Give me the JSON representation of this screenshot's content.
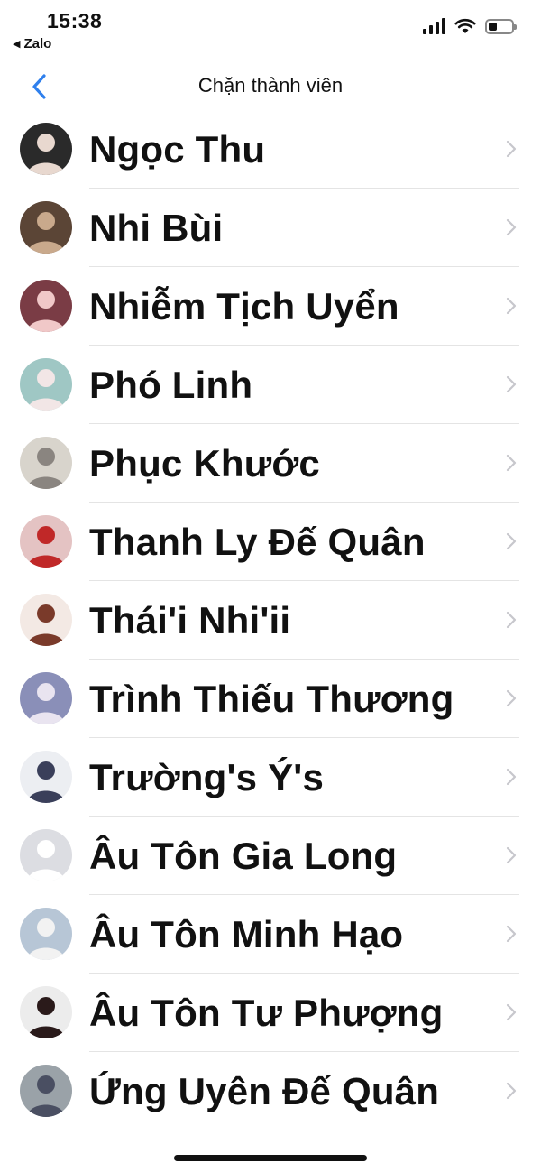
{
  "status_bar": {
    "time": "15:38",
    "back_app_label": "Zalo"
  },
  "nav": {
    "title": "Chặn thành viên",
    "back_icon": "chevron-left-icon",
    "accent_color": "#2f80ed"
  },
  "members": [
    {
      "name": "Ngọc Thu",
      "avatar": {
        "bg": "#2a2a2a",
        "fg": "#e8d8cf"
      }
    },
    {
      "name": "Nhi Bùi",
      "avatar": {
        "bg": "#5b4536",
        "fg": "#c9a98c"
      }
    },
    {
      "name": "Nhiễm Tịch Uyển",
      "avatar": {
        "bg": "#7a3c45",
        "fg": "#f0c8c8"
      }
    },
    {
      "name": "Phó Linh",
      "avatar": {
        "bg": "#9fc7c4",
        "fg": "#f2e6e6"
      }
    },
    {
      "name": "Phục Khước",
      "avatar": {
        "bg": "#d8d4cc",
        "fg": "#8a8580"
      }
    },
    {
      "name": "Thanh Ly Đế Quân",
      "avatar": {
        "bg": "#e4c3c3",
        "fg": "#c02828"
      }
    },
    {
      "name": "Thái'i Nhi'ii",
      "avatar": {
        "bg": "#f3e9e4",
        "fg": "#7a3a2a"
      }
    },
    {
      "name": "Trình Thiếu Thương",
      "avatar": {
        "bg": "#8a8fb8",
        "fg": "#e9e4f0"
      }
    },
    {
      "name": "Trường's Ý's",
      "avatar": {
        "bg": "#eceef2",
        "fg": "#3a3f5a"
      }
    },
    {
      "name": "Âu Tôn Gia Long",
      "avatar": {
        "bg": "#dcdde2",
        "fg": "#ffffff"
      }
    },
    {
      "name": "Âu Tôn Minh Hạo",
      "avatar": {
        "bg": "#b7c6d6",
        "fg": "#f2f2f2"
      }
    },
    {
      "name": "Âu Tôn Tư Phượng",
      "avatar": {
        "bg": "#ececec",
        "fg": "#2a1a1a"
      }
    },
    {
      "name": "Ứng Uyên Đế Quân",
      "avatar": {
        "bg": "#9aa2a8",
        "fg": "#4a4f62"
      }
    }
  ]
}
